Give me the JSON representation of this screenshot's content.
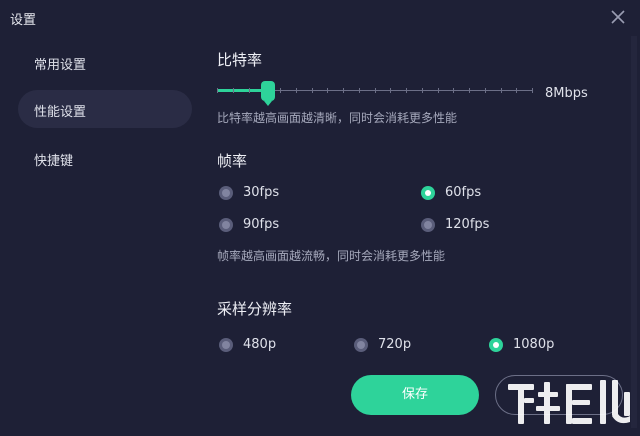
{
  "window": {
    "title": "设置"
  },
  "sidebar": {
    "items": [
      {
        "label": "常用设置",
        "active": false
      },
      {
        "label": "性能设置",
        "active": true
      },
      {
        "label": "快捷键",
        "active": false
      }
    ]
  },
  "bitrate": {
    "heading": "比特率",
    "value_label": "8Mbps",
    "position_fraction": 0.16,
    "hint": "比特率越高画面越清晰，同时会消耗更多性能"
  },
  "framerate": {
    "heading": "帧率",
    "options": [
      {
        "label": "30fps",
        "checked": false
      },
      {
        "label": "60fps",
        "checked": true
      },
      {
        "label": "90fps",
        "checked": false
      },
      {
        "label": "120fps",
        "checked": false
      }
    ],
    "hint": "帧率越高画面越流畅，同时会消耗更多性能"
  },
  "resolution": {
    "heading": "采样分辨率",
    "options": [
      {
        "label": "480p",
        "checked": false
      },
      {
        "label": "720p",
        "checked": false
      },
      {
        "label": "1080p",
        "checked": true
      }
    ]
  },
  "actions": {
    "save_label": "保存"
  },
  "colors": {
    "accent": "#2ed39a",
    "background": "#1e2036",
    "active_item": "#2a2c45"
  },
  "icons": {
    "close": "close-icon",
    "watermark": "site-watermark-logo"
  }
}
